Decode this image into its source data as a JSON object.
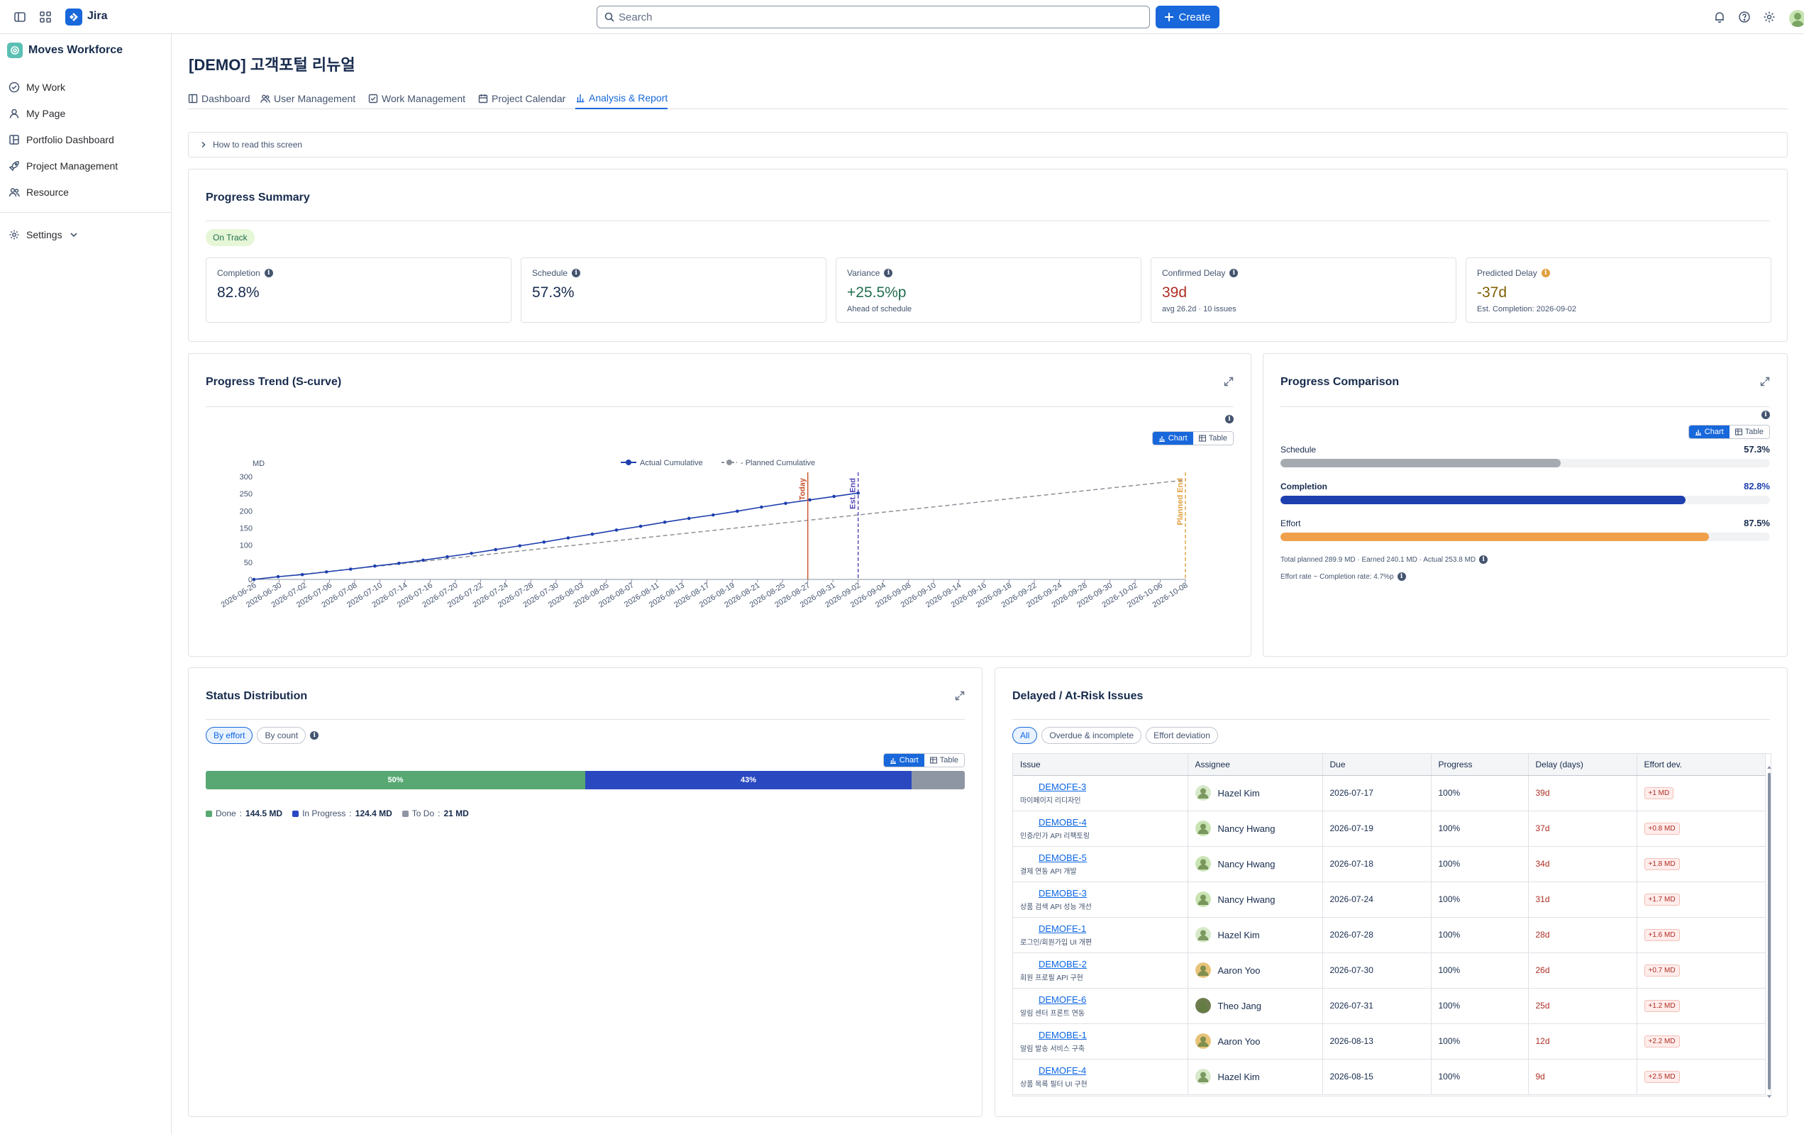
{
  "app": {
    "name": "Jira"
  },
  "search": {
    "placeholder": "Search",
    "value": ""
  },
  "create_label": "Create",
  "sidebar": {
    "space_name": "Moves Workforce",
    "items": [
      {
        "label": "My Work",
        "icon": "check-circle-icon"
      },
      {
        "label": "My Page",
        "icon": "person-icon"
      },
      {
        "label": "Portfolio Dashboard",
        "icon": "board-icon"
      },
      {
        "label": "Project Management",
        "icon": "rocket-icon"
      },
      {
        "label": "Resource",
        "icon": "people-icon"
      }
    ],
    "settings_label": "Settings"
  },
  "page": {
    "title": "[DEMO] 고객포털 리뉴얼",
    "tabs": [
      {
        "label": "Dashboard",
        "active": false
      },
      {
        "label": "User Management",
        "active": false
      },
      {
        "label": "Work Management",
        "active": false
      },
      {
        "label": "Project Calendar",
        "active": false
      },
      {
        "label": "Analysis & Report",
        "active": true
      }
    ],
    "howto_label": "How to read this screen"
  },
  "progress_summary": {
    "title": "Progress Summary",
    "status_badge": "On Track",
    "metrics": [
      {
        "label": "Completion",
        "value": "82.8%",
        "sub": "",
        "color": "#172b4d"
      },
      {
        "label": "Schedule",
        "value": "57.3%",
        "sub": "",
        "color": "#172b4d"
      },
      {
        "label": "Variance",
        "value": "+25.5%p",
        "sub": "Ahead of schedule",
        "color": "#216e4e"
      },
      {
        "label": "Confirmed Delay",
        "value": "39d",
        "sub": "avg 26.2d · 10 issues",
        "color": "#ae2e24"
      },
      {
        "label": "Predicted Delay",
        "value": "-37d",
        "sub": "Est. Completion: 2026-09-02",
        "color": "#7f5f01"
      }
    ]
  },
  "view_toggle": {
    "chart": "Chart",
    "table": "Table"
  },
  "progress_trend": {
    "title": "Progress Trend (S-curve)",
    "markers": {
      "today": "Today",
      "est_end": "Est. End",
      "planned_end": "Planned End"
    }
  },
  "chart_data": {
    "type": "line",
    "title": "Progress Trend (S-curve)",
    "ylabel": "MD",
    "ylim": [
      0,
      300
    ],
    "yticks": [
      0,
      50,
      100,
      150,
      200,
      250,
      300
    ],
    "legend_position": "top-center",
    "grid": false,
    "x": [
      "2026-06-26",
      "2026-06-30",
      "2026-07-02",
      "2026-07-06",
      "2026-07-08",
      "2026-07-10",
      "2026-07-14",
      "2026-07-16",
      "2026-07-20",
      "2026-07-22",
      "2026-07-24",
      "2026-07-28",
      "2026-07-30",
      "2026-08-03",
      "2026-08-05",
      "2026-08-07",
      "2026-08-11",
      "2026-08-13",
      "2026-08-17",
      "2026-08-19",
      "2026-08-21",
      "2026-08-25",
      "2026-08-27",
      "2026-08-31",
      "2026-09-02",
      "2026-09-04",
      "2026-09-08",
      "2026-09-10",
      "2026-09-14",
      "2026-09-16",
      "2026-09-18",
      "2026-09-22",
      "2026-09-24",
      "2026-09-28",
      "2026-09-30",
      "2026-10-02",
      "2026-10-06",
      "2026-10-08"
    ],
    "series": [
      {
        "name": "Actual Cumulative",
        "color": "#1e3fae",
        "dashed": false,
        "markers": true,
        "values": [
          0,
          8,
          14,
          22,
          30,
          39,
          47,
          56,
          66,
          76,
          87,
          98,
          109,
          121,
          132,
          144,
          155,
          167,
          178,
          188,
          199,
          211,
          222,
          232,
          242,
          252
        ]
      },
      {
        "name": "Planned Cumulative",
        "color": "#8c9199",
        "dashed": true,
        "markers": false,
        "values": [
          0,
          290
        ]
      }
    ],
    "vertical_markers": [
      {
        "label": "Today",
        "x": "2026-08-27",
        "color": "#c9522b",
        "style": "solid"
      },
      {
        "label": "Est. End",
        "x": "2026-09-02",
        "color": "#4f46b5",
        "style": "dashed"
      },
      {
        "label": "Planned End",
        "x": "2026-10-08",
        "color": "#e2a03f",
        "style": "dashed"
      }
    ]
  },
  "progress_comparison": {
    "title": "Progress Comparison",
    "bars": [
      {
        "label": "Schedule",
        "value_text": "57.3%",
        "fraction": 0.573,
        "color": "#a5a9b0",
        "bold": false
      },
      {
        "label": "Completion",
        "value_text": "82.8%",
        "fraction": 0.828,
        "color": "#1e3fae",
        "bold": true,
        "value_color": "#1e3fae"
      },
      {
        "label": "Effort",
        "value_text": "87.5%",
        "fraction": 0.875,
        "color": "#f0a04b",
        "bold": false
      }
    ],
    "note1": "Total planned 289.9 MD · Earned 240.1 MD · Actual 253.8 MD",
    "note2": "Effort rate − Completion rate: 4.7%p"
  },
  "status_distribution": {
    "title": "Status Distribution",
    "filters": [
      {
        "label": "By effort",
        "active": true
      },
      {
        "label": "By count",
        "active": false
      }
    ],
    "segments": [
      {
        "label": "Done",
        "value": "144.5 MD",
        "fraction": 0.5,
        "text": "50%",
        "color": "#57a872"
      },
      {
        "label": "In Progress",
        "value": "124.4 MD",
        "fraction": 0.43,
        "text": "43%",
        "color": "#2a49c1"
      },
      {
        "label": "To Do",
        "value": "21 MD",
        "fraction": 0.07,
        "text": "",
        "color": "#8f96a3"
      }
    ]
  },
  "delayed_issues": {
    "title": "Delayed / At-Risk Issues",
    "filters": [
      {
        "label": "All",
        "active": true
      },
      {
        "label": "Overdue & incomplete",
        "active": false
      },
      {
        "label": "Effort deviation",
        "active": false
      }
    ],
    "columns": [
      "Issue",
      "Assignee",
      "Due",
      "Progress",
      "Delay (days)",
      "Effort dev."
    ],
    "rows": [
      {
        "key": "DEMOFE-3",
        "summary": "마이페이지 리디자인",
        "assignee": "Hazel Kim",
        "due": "2026-07-17",
        "progress": "100%",
        "delay": "39d",
        "effort": "+1 MD",
        "avatar": "#d7e9c9"
      },
      {
        "key": "DEMOBE-4",
        "summary": "인증/인가 API 리팩토링",
        "assignee": "Nancy Hwang",
        "due": "2026-07-19",
        "progress": "100%",
        "delay": "37d",
        "effort": "+0.8 MD",
        "avatar": "#c9e4b3"
      },
      {
        "key": "DEMOBE-5",
        "summary": "결제 연동 API 개발",
        "assignee": "Nancy Hwang",
        "due": "2026-07-18",
        "progress": "100%",
        "delay": "34d",
        "effort": "+1.8 MD",
        "avatar": "#c9e4b3"
      },
      {
        "key": "DEMOBE-3",
        "summary": "상품 검색 API 성능 개선",
        "assignee": "Nancy Hwang",
        "due": "2026-07-24",
        "progress": "100%",
        "delay": "31d",
        "effort": "+1.7 MD",
        "avatar": "#c9e4b3"
      },
      {
        "key": "DEMOFE-1",
        "summary": "로그인/회원가입 UI 개편",
        "assignee": "Hazel Kim",
        "due": "2026-07-28",
        "progress": "100%",
        "delay": "28d",
        "effort": "+1.6 MD",
        "avatar": "#d7e9c9"
      },
      {
        "key": "DEMOBE-2",
        "summary": "회원 프로필 API 구현",
        "assignee": "Aaron Yoo",
        "due": "2026-07-30",
        "progress": "100%",
        "delay": "26d",
        "effort": "+0.7 MD",
        "avatar": "#e7c37a"
      },
      {
        "key": "DEMOFE-6",
        "summary": "알림 센터 프론트 연동",
        "assignee": "Theo Jang",
        "due": "2026-07-31",
        "progress": "100%",
        "delay": "25d",
        "effort": "+1.2 MD",
        "avatar": "#6d7b4e"
      },
      {
        "key": "DEMOBE-1",
        "summary": "알림 발송 서비스 구축",
        "assignee": "Aaron Yoo",
        "due": "2026-08-13",
        "progress": "100%",
        "delay": "12d",
        "effort": "+2.2 MD",
        "avatar": "#e7c37a"
      },
      {
        "key": "DEMOFE-4",
        "summary": "상품 목록 필터 UI 구현",
        "assignee": "Hazel Kim",
        "due": "2026-08-15",
        "progress": "100%",
        "delay": "9d",
        "effort": "+2.5 MD",
        "avatar": "#d7e9c9"
      }
    ]
  }
}
